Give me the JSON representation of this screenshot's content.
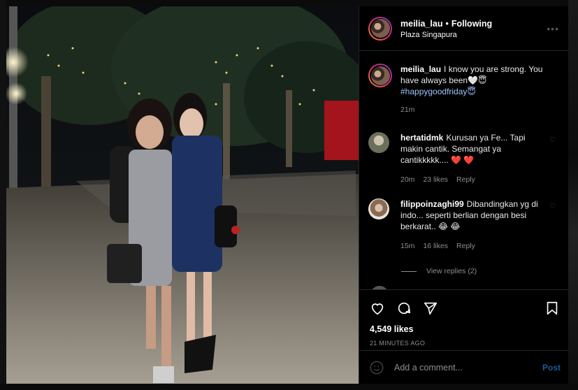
{
  "post": {
    "username": "meilia_lau",
    "following_label": "Following",
    "location": "Plaza Singapura",
    "caption_text": "I know you are strong. You have always been🤍😇",
    "caption_hashtag": "#happygoodfriday😇",
    "caption_time": "21m",
    "likes": "4,549 likes",
    "time_ago": "21 MINUTES AGO"
  },
  "comments": [
    {
      "username": "hertatidmk",
      "text": "Kurusan ya Fe... Tapi makin cantik. Semangat ya cantikkkkk.... ❤️ ❤️",
      "time": "20m",
      "likes": "23 likes",
      "reply_label": "Reply"
    },
    {
      "username": "filippoinzaghi99",
      "text": "Dibandingkan yg di indo... seperti berlian dengan besi berkarat.. 😂 😂",
      "time": "15m",
      "likes": "16 likes",
      "reply_label": "Reply",
      "view_replies": "View replies (2)"
    }
  ],
  "composer": {
    "placeholder": "Add a comment...",
    "post_label": "Post"
  },
  "icons": {
    "more": "more-options-icon",
    "like": "heart-icon",
    "comment": "comment-icon",
    "share": "share-icon",
    "save": "bookmark-icon",
    "emoji": "smiley-icon"
  },
  "colors": {
    "background": "#000000",
    "divider": "#262626",
    "muted_text": "#8e8e8e",
    "hashtag": "#9ec5ff",
    "post_button": "#1c5b8f",
    "heart": "#ed2b3b"
  }
}
